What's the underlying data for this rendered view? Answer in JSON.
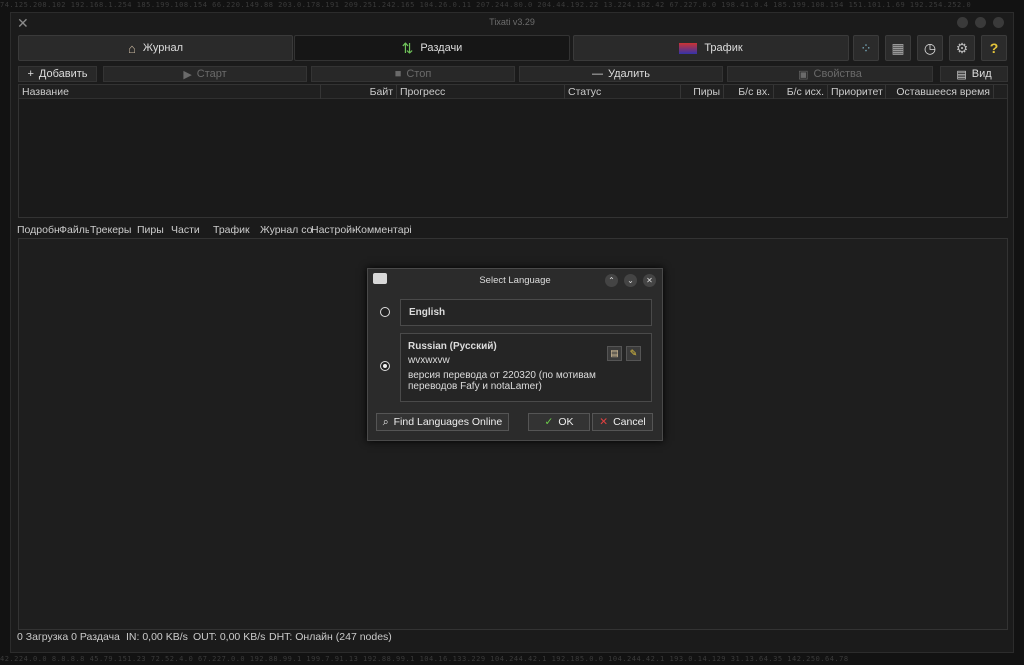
{
  "window": {
    "title": "Tixati v3.29"
  },
  "bg_numbers": {
    "top": "74.125.208.102 192.168.1.254 185.199.108.154 66.220.149.88 203.0.178.191 209.251.242.165 104.26.0.11 207.244.80.0 204.44.192.22 13.224.182.42 67.227.0.0 198.41.0.4 185.199.108.154 151.101.1.69 192.254.252.0",
    "bottom": "42.224.0.0 8.8.8.8 45.79.151.23 72.52.4.0 67.227.0.0 192.88.99.1 199.7.91.13 192.88.99.1 104.16.133.229 104.244.42.1 192.185.0.0 104.244.42.1 193.0.14.129 31.13.64.35 142.250.64.78"
  },
  "main_tabs": [
    {
      "label": "Журнал"
    },
    {
      "label": "Раздачи"
    },
    {
      "label": "Трафик"
    }
  ],
  "toolbar": {
    "add": "Добавить",
    "start": "Старт",
    "stop": "Стоп",
    "remove": "Удалить",
    "properties": "Свойства",
    "view": "Вид"
  },
  "columns": [
    "Название",
    "Байт",
    "Прогресс",
    "Статус",
    "Пиры",
    "Б/с вх.",
    "Б/с исх.",
    "Приоритет",
    "Оставшееся время"
  ],
  "sub_tabs": [
    "Подробн",
    "Файлы",
    "Трекеры",
    "Пиры",
    "Части",
    "Трафик",
    "Журнал со",
    "Настройк",
    "Комментарі"
  ],
  "status_bar": {
    "transfers": "0 Загрузка  0 Раздача",
    "in": "IN: 0,00 KB/s",
    "out": "OUT: 0,00 KB/s",
    "dht": "DHT: Онлайн (247 nodes)"
  },
  "dialog": {
    "title": "Select Language",
    "lang1": {
      "name": "English",
      "selected": false
    },
    "lang2": {
      "name": "Russian (Русский)",
      "line1": "wvxwxvw",
      "line2": "версия перевода от 220320 (по мотивам",
      "line3": "переводов Fafy и notaLamer)",
      "selected": true
    },
    "find_online": "Find Languages Online",
    "ok": "OK",
    "cancel": "Cancel"
  }
}
